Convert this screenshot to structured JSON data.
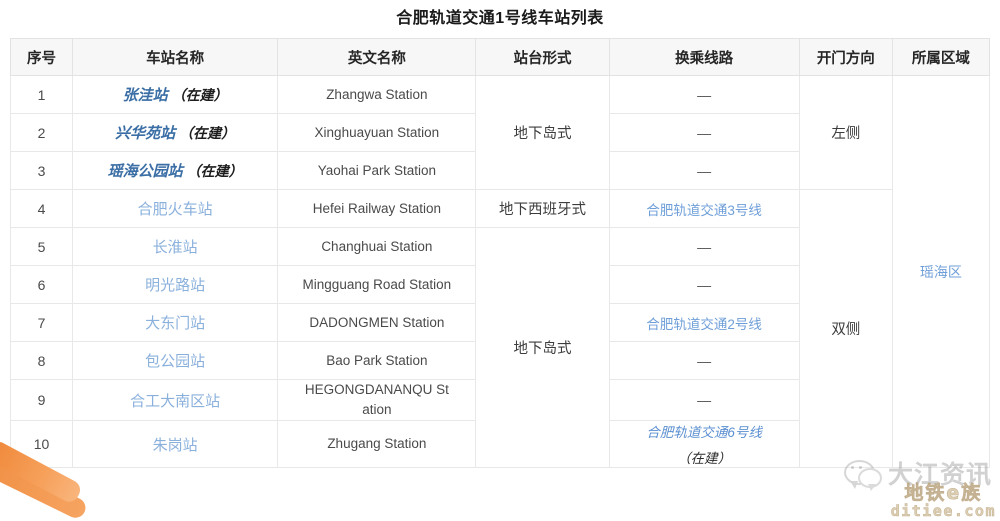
{
  "title": "合肥轨道交通1号线车站列表",
  "table": {
    "headers": [
      "序号",
      "车站名称",
      "英文名称",
      "站台形式",
      "换乘线路",
      "开门方向",
      "所属区域"
    ],
    "rows": [
      {
        "index": "1",
        "cn_name": "张洼站",
        "cn_suffix": "（在建）",
        "under_construction": true,
        "en_name": "Zhangwa Station",
        "transfer": "—",
        "transfer_is_link": false
      },
      {
        "index": "2",
        "cn_name": "兴华苑站",
        "cn_suffix": "（在建）",
        "under_construction": true,
        "en_name": "Xinghuayuan Station",
        "transfer": "—",
        "transfer_is_link": false
      },
      {
        "index": "3",
        "cn_name": "瑶海公园站",
        "cn_suffix": "（在建）",
        "under_construction": true,
        "en_name": "Yaohai Park Station",
        "transfer": "—",
        "transfer_is_link": false
      },
      {
        "index": "4",
        "cn_name": "合肥火车站",
        "cn_suffix": "",
        "under_construction": false,
        "en_name": "Hefei Railway Station",
        "transfer": "合肥轨道交通3号线",
        "transfer_is_link": true
      },
      {
        "index": "5",
        "cn_name": "长淮站",
        "cn_suffix": "",
        "under_construction": false,
        "en_name": "Changhuai Station",
        "transfer": "—",
        "transfer_is_link": false
      },
      {
        "index": "6",
        "cn_name": "明光路站",
        "cn_suffix": "",
        "under_construction": false,
        "en_name": "Mingguang Road Station",
        "transfer": "—",
        "transfer_is_link": false
      },
      {
        "index": "7",
        "cn_name": "大东门站",
        "cn_suffix": "",
        "under_construction": false,
        "en_name": "DADONGMEN Station",
        "transfer": "合肥轨道交通2号线",
        "transfer_is_link": true
      },
      {
        "index": "8",
        "cn_name": "包公园站",
        "cn_suffix": "",
        "under_construction": false,
        "en_name": "Bao Park Station",
        "transfer": "—",
        "transfer_is_link": false
      },
      {
        "index": "9",
        "cn_name": "合工大南区站",
        "cn_suffix": "",
        "under_construction": false,
        "en_name": "HEGONGDANANQU St ation",
        "en_name_line1": "HEGONGDANANQU St",
        "en_name_line2": "ation",
        "transfer": "—",
        "transfer_is_link": false
      },
      {
        "index": "10",
        "cn_name": "朱岗站",
        "cn_suffix": "",
        "under_construction": false,
        "en_name": "Zhugang Station",
        "transfer": "合肥轨道交通6号线",
        "transfer_sub": "（在建）",
        "transfer_is_link": true,
        "transfer_building": true
      }
    ],
    "merged": {
      "platform_1_3": "地下岛式",
      "platform_4": "地下西班牙式",
      "platform_5_10": "地下岛式",
      "door_1_3": "左侧",
      "door_4_10": "双侧",
      "zone_all": "瑶海区"
    }
  },
  "watermarks": {
    "dajiang_text": "大江资讯",
    "ditie_line1": "地铁e族",
    "ditie_line2": "ditiee.com"
  },
  "colors": {
    "link_blue": "#8ab0dc",
    "link_blue_strong": "#3a6ea5",
    "header_bg": "#f7f7f7",
    "border": "#e8e8e8",
    "accent_orange": "#f08a3c"
  }
}
